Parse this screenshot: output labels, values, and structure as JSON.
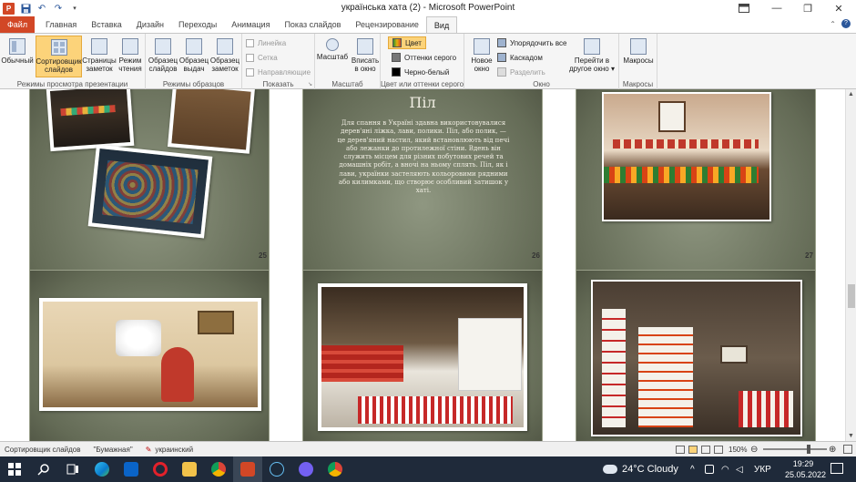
{
  "window": {
    "title": "українська хата (2)  -  Microsoft PowerPoint",
    "minimize": "—",
    "maximize": "❐",
    "close": "✕",
    "help": "?"
  },
  "quick_access": {
    "logo": "P",
    "undo": "↶",
    "redo": "↷"
  },
  "tabs": [
    "Файл",
    "Главная",
    "Вставка",
    "Дизайн",
    "Переходы",
    "Анимация",
    "Показ слайдов",
    "Рецензирование",
    "Вид"
  ],
  "ribbon": {
    "views": {
      "label": "Режимы просмотра презентации",
      "normal": "Обычный",
      "sorter": "Сортировщик\nслайдов",
      "notes": "Страницы\nзаметок",
      "reading": "Режим\nчтения"
    },
    "masters": {
      "label": "Режимы образцов",
      "slide": "Образец\nслайдов",
      "handout": "Образец\nвыдач",
      "notes": "Образец\nзаметок"
    },
    "show": {
      "label": "Показать",
      "ruler": "Линейка",
      "grid": "Сетка",
      "guides": "Направляющие"
    },
    "zoom": {
      "label": "Масштаб",
      "zoom": "Масштаб",
      "fit": "Вписать\nв окно"
    },
    "color": {
      "label": "Цвет или оттенки серого",
      "color": "Цвет",
      "gray": "Оттенки серого",
      "bw": "Черно-белый"
    },
    "window": {
      "label": "Окно",
      "new": "Новое\nокно",
      "arrange": "Упорядочить все",
      "cascade": "Каскадом",
      "split": "Разделить",
      "switch": "Перейти в\nдругое окно ▾"
    },
    "macros": {
      "label": "Макросы",
      "macros": "Макросы"
    }
  },
  "slides": {
    "s25": {
      "num": "25"
    },
    "s26": {
      "num": "26",
      "title": "Піл",
      "body": "Для спання в Україні здавна використовувалися дерев'яні ліжка, лави, полики. Піл, або полик, — це дерев'яний настил, який встановлюють від печі або лежанки до протилежної стіни. Вдень він служить місцем для різних побутових речей та домашніх робіт, а вночі на ньому сплять. Піл, як і лави, українки застеляють кольоровими рядними або килимками, що створює особливий затишок у хаті."
    },
    "s27": {
      "num": "27"
    }
  },
  "status": {
    "view": "Сортировщик слайдов",
    "theme": "\"Бумажная\"",
    "lang": "украинский",
    "zoom": "150%"
  },
  "taskbar": {
    "weather": "24°C  Cloudy",
    "lang": "УКР",
    "time": "19:29",
    "date": "25.05.2022",
    "tray_arrow": "^"
  },
  "colors": {
    "accent": "#d24726",
    "ribbon_bg": "#f5f5f5",
    "slide_bg": "#5d6350"
  }
}
